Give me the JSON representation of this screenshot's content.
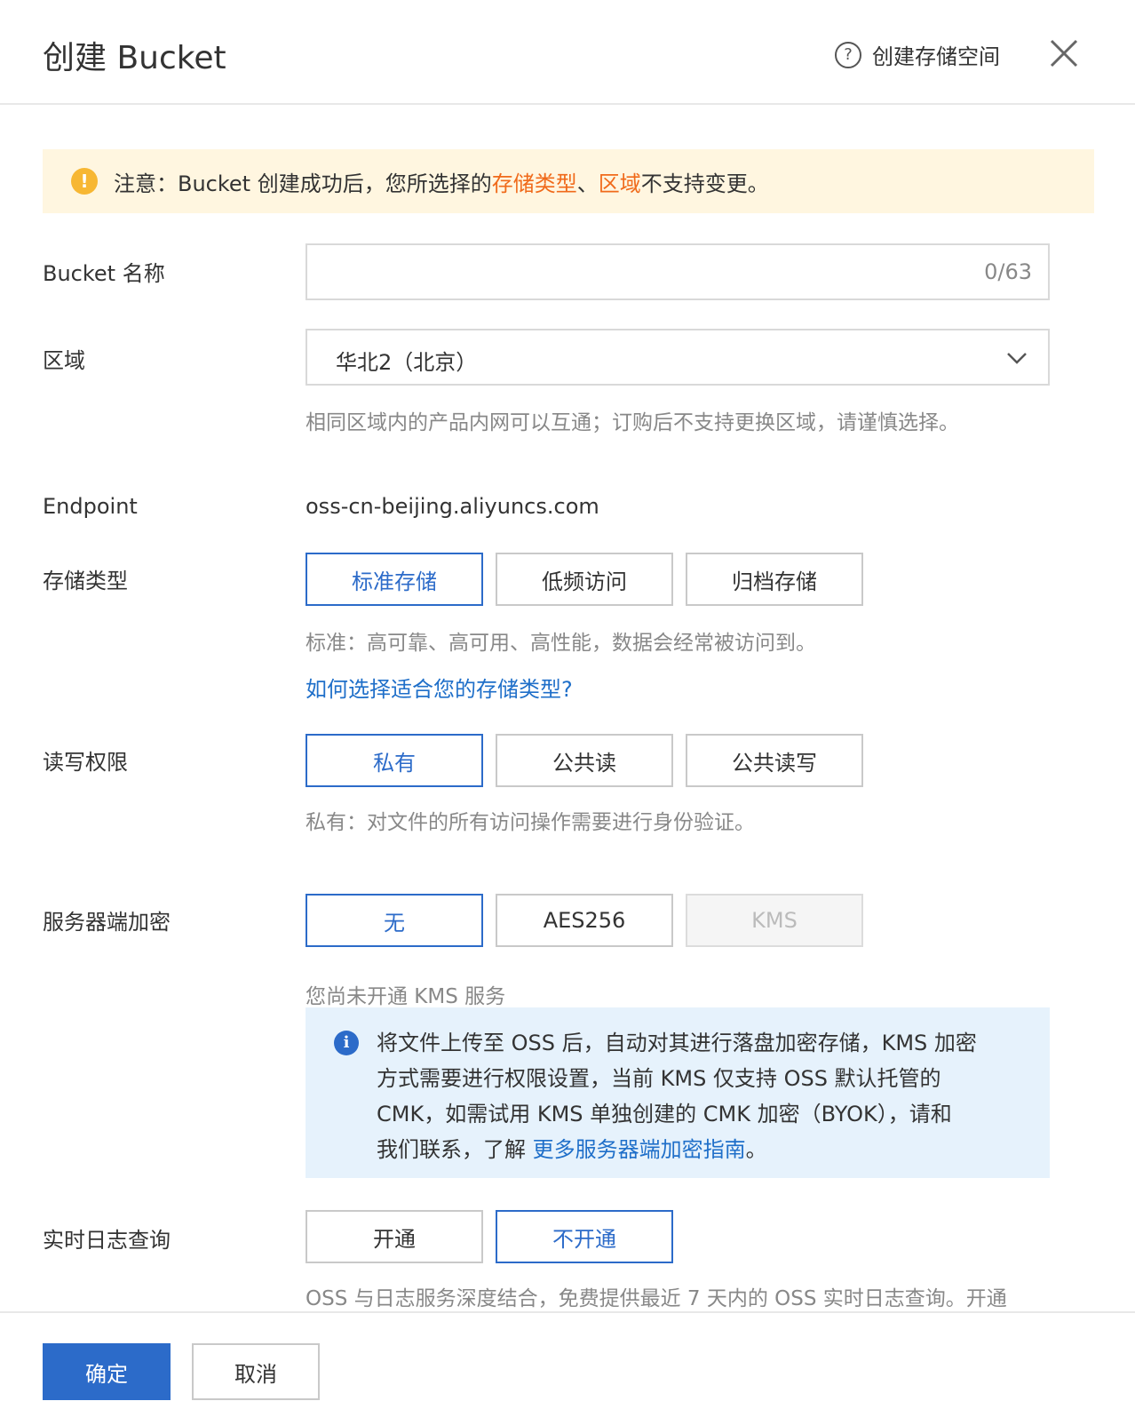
{
  "header": {
    "title": "创建 Bucket",
    "help_label": "创建存储空间"
  },
  "notice": {
    "prefix": "注意：Bucket 创建成功后，您所选择的 ",
    "storage_type": "存储类型",
    "separator": "、",
    "region": "区域",
    "suffix": " 不支持变更。"
  },
  "bucket_name": {
    "label": "Bucket 名称",
    "counter": "0/63"
  },
  "region": {
    "label": "区域",
    "value": "华北2（北京）",
    "hint": "相同区域内的产品内网可以互通；订购后不支持更换区域，请谨慎选择。"
  },
  "endpoint": {
    "label": "Endpoint",
    "value": "oss-cn-beijing.aliyuncs.com"
  },
  "storage_class": {
    "label": "存储类型",
    "options": [
      "标准存储",
      "低频访问",
      "归档存储"
    ],
    "selected": "标准存储",
    "hint": "标准：高可靠、高可用、高性能，数据会经常被访问到。",
    "link": "如何选择适合您的存储类型?"
  },
  "acl": {
    "label": "读写权限",
    "options": [
      "私有",
      "公共读",
      "公共读写"
    ],
    "selected": "私有",
    "hint": "私有：对文件的所有访问操作需要进行身份验证。"
  },
  "encryption": {
    "label": "服务器端加密",
    "options": [
      "无",
      "AES256",
      "KMS"
    ],
    "selected": "无",
    "disabled": "KMS",
    "kms_hint": "您尚未开通 KMS 服务",
    "info_lines": [
      "将文件上传至 OSS 后，自动对其进行落盘加密存储，KMS 加密",
      "方式需要进行权限设置，当前 KMS 仅支持 OSS 默认托管的",
      "CMK，如需试用 KMS 单独创建的 CMK 加密（BYOK），请和"
    ],
    "info_last_prefix": "我们联系，了解 ",
    "info_link": "更多服务器端加密指南",
    "info_last_suffix": "。"
  },
  "realtime_log": {
    "label": "实时日志查询",
    "options": [
      "开通",
      "不开通"
    ],
    "selected": "不开通",
    "hint": "OSS 与日志服务深度结合，免费提供最近 7 天内的 OSS 实时日志查询。开通"
  },
  "footer": {
    "confirm": "确定",
    "cancel": "取消"
  },
  "colors": {
    "primary": "#2c6bc9",
    "warning": "#f7b733",
    "notice_bg": "#fff6e0",
    "info_bg": "#e6f2fc",
    "orange_text": "#f06a1a"
  }
}
